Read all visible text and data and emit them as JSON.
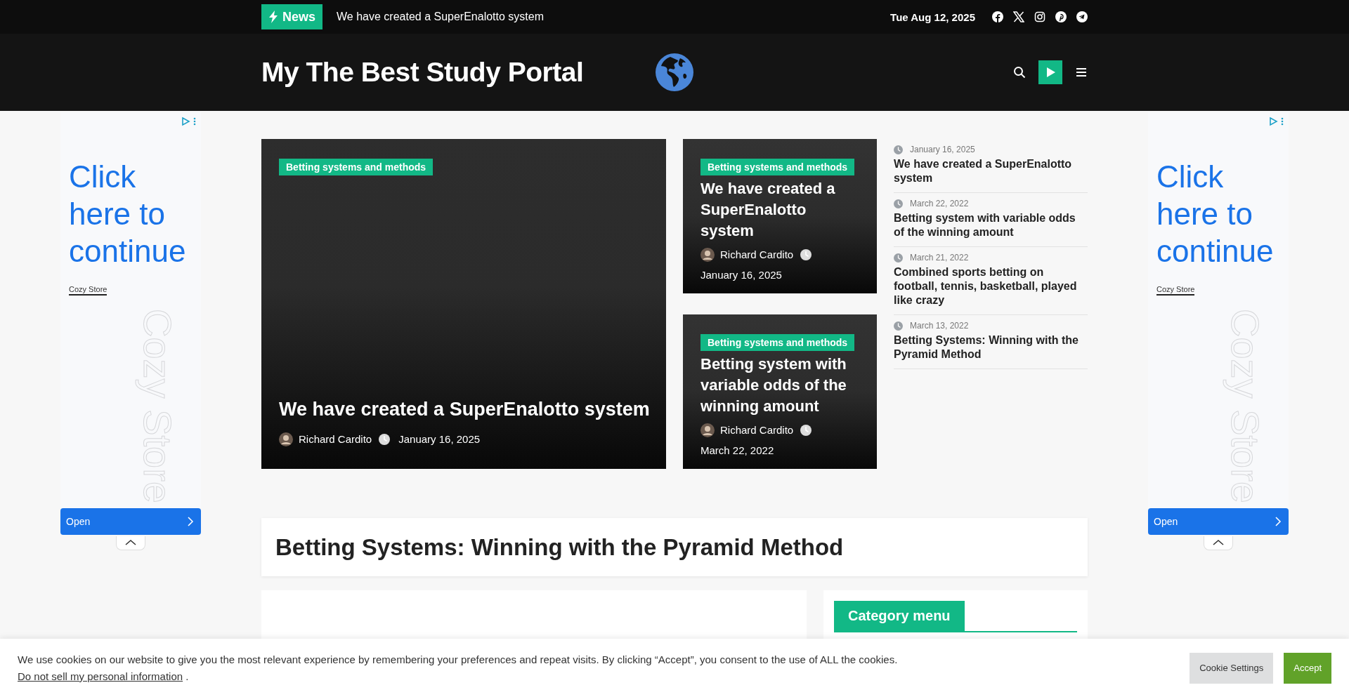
{
  "top_bar": {
    "badge": "News",
    "ticker": "We have created a SuperEnalotto system",
    "date": "Tue Aug 12, 2025"
  },
  "header": {
    "site_title": "My The Best Study Portal"
  },
  "ads": [
    {
      "headline": "Click here to continue",
      "advertiser": "Cozy Store",
      "background_text": "Cozy Store",
      "button": "Open"
    },
    {
      "headline": "Click here to continue",
      "advertiser": "Cozy Store",
      "background_text": "Cozy Store",
      "button": "Open"
    }
  ],
  "featured": {
    "category": "Betting systems and methods",
    "title": "We have created a SuperEnalotto system",
    "author": "Richard Cardito",
    "date": "January 16, 2025"
  },
  "cards": [
    {
      "category": "Betting systems and methods",
      "title": "We have created a SuperEnalotto system",
      "author": "Richard Cardito",
      "date": "January 16, 2025"
    },
    {
      "category": "Betting systems and methods",
      "title": "Betting system with variable odds of the winning amount",
      "author": "Richard Cardito",
      "date": "March 22, 2022"
    }
  ],
  "recent": [
    {
      "date": "January 16, 2025",
      "title": "We have created a SuperEnalotto system"
    },
    {
      "date": "March 22, 2022",
      "title": "Betting system with variable odds of the winning amount"
    },
    {
      "date": "March 21, 2022",
      "title": "Combined sports betting on football, tennis, basketball, played like crazy"
    },
    {
      "date": "March 13, 2022",
      "title": "Betting Systems: Winning with the Pyramid Method"
    }
  ],
  "article_title": "Betting Systems: Winning with the Pyramid Method",
  "sidebar": {
    "heading": "Category menu"
  },
  "cookie": {
    "text": "We use cookies on our website to give you the most relevant experience by remembering your preferences and repeat visits. By clicking “Accept”, you consent to the use of ALL the cookies.",
    "link": "Do not sell my personal information",
    "link_suffix": ".",
    "buttons": [
      {
        "label": "Cookie Settings",
        "kind": "secondary"
      },
      {
        "label": "Accept",
        "kind": "primary"
      }
    ]
  }
}
